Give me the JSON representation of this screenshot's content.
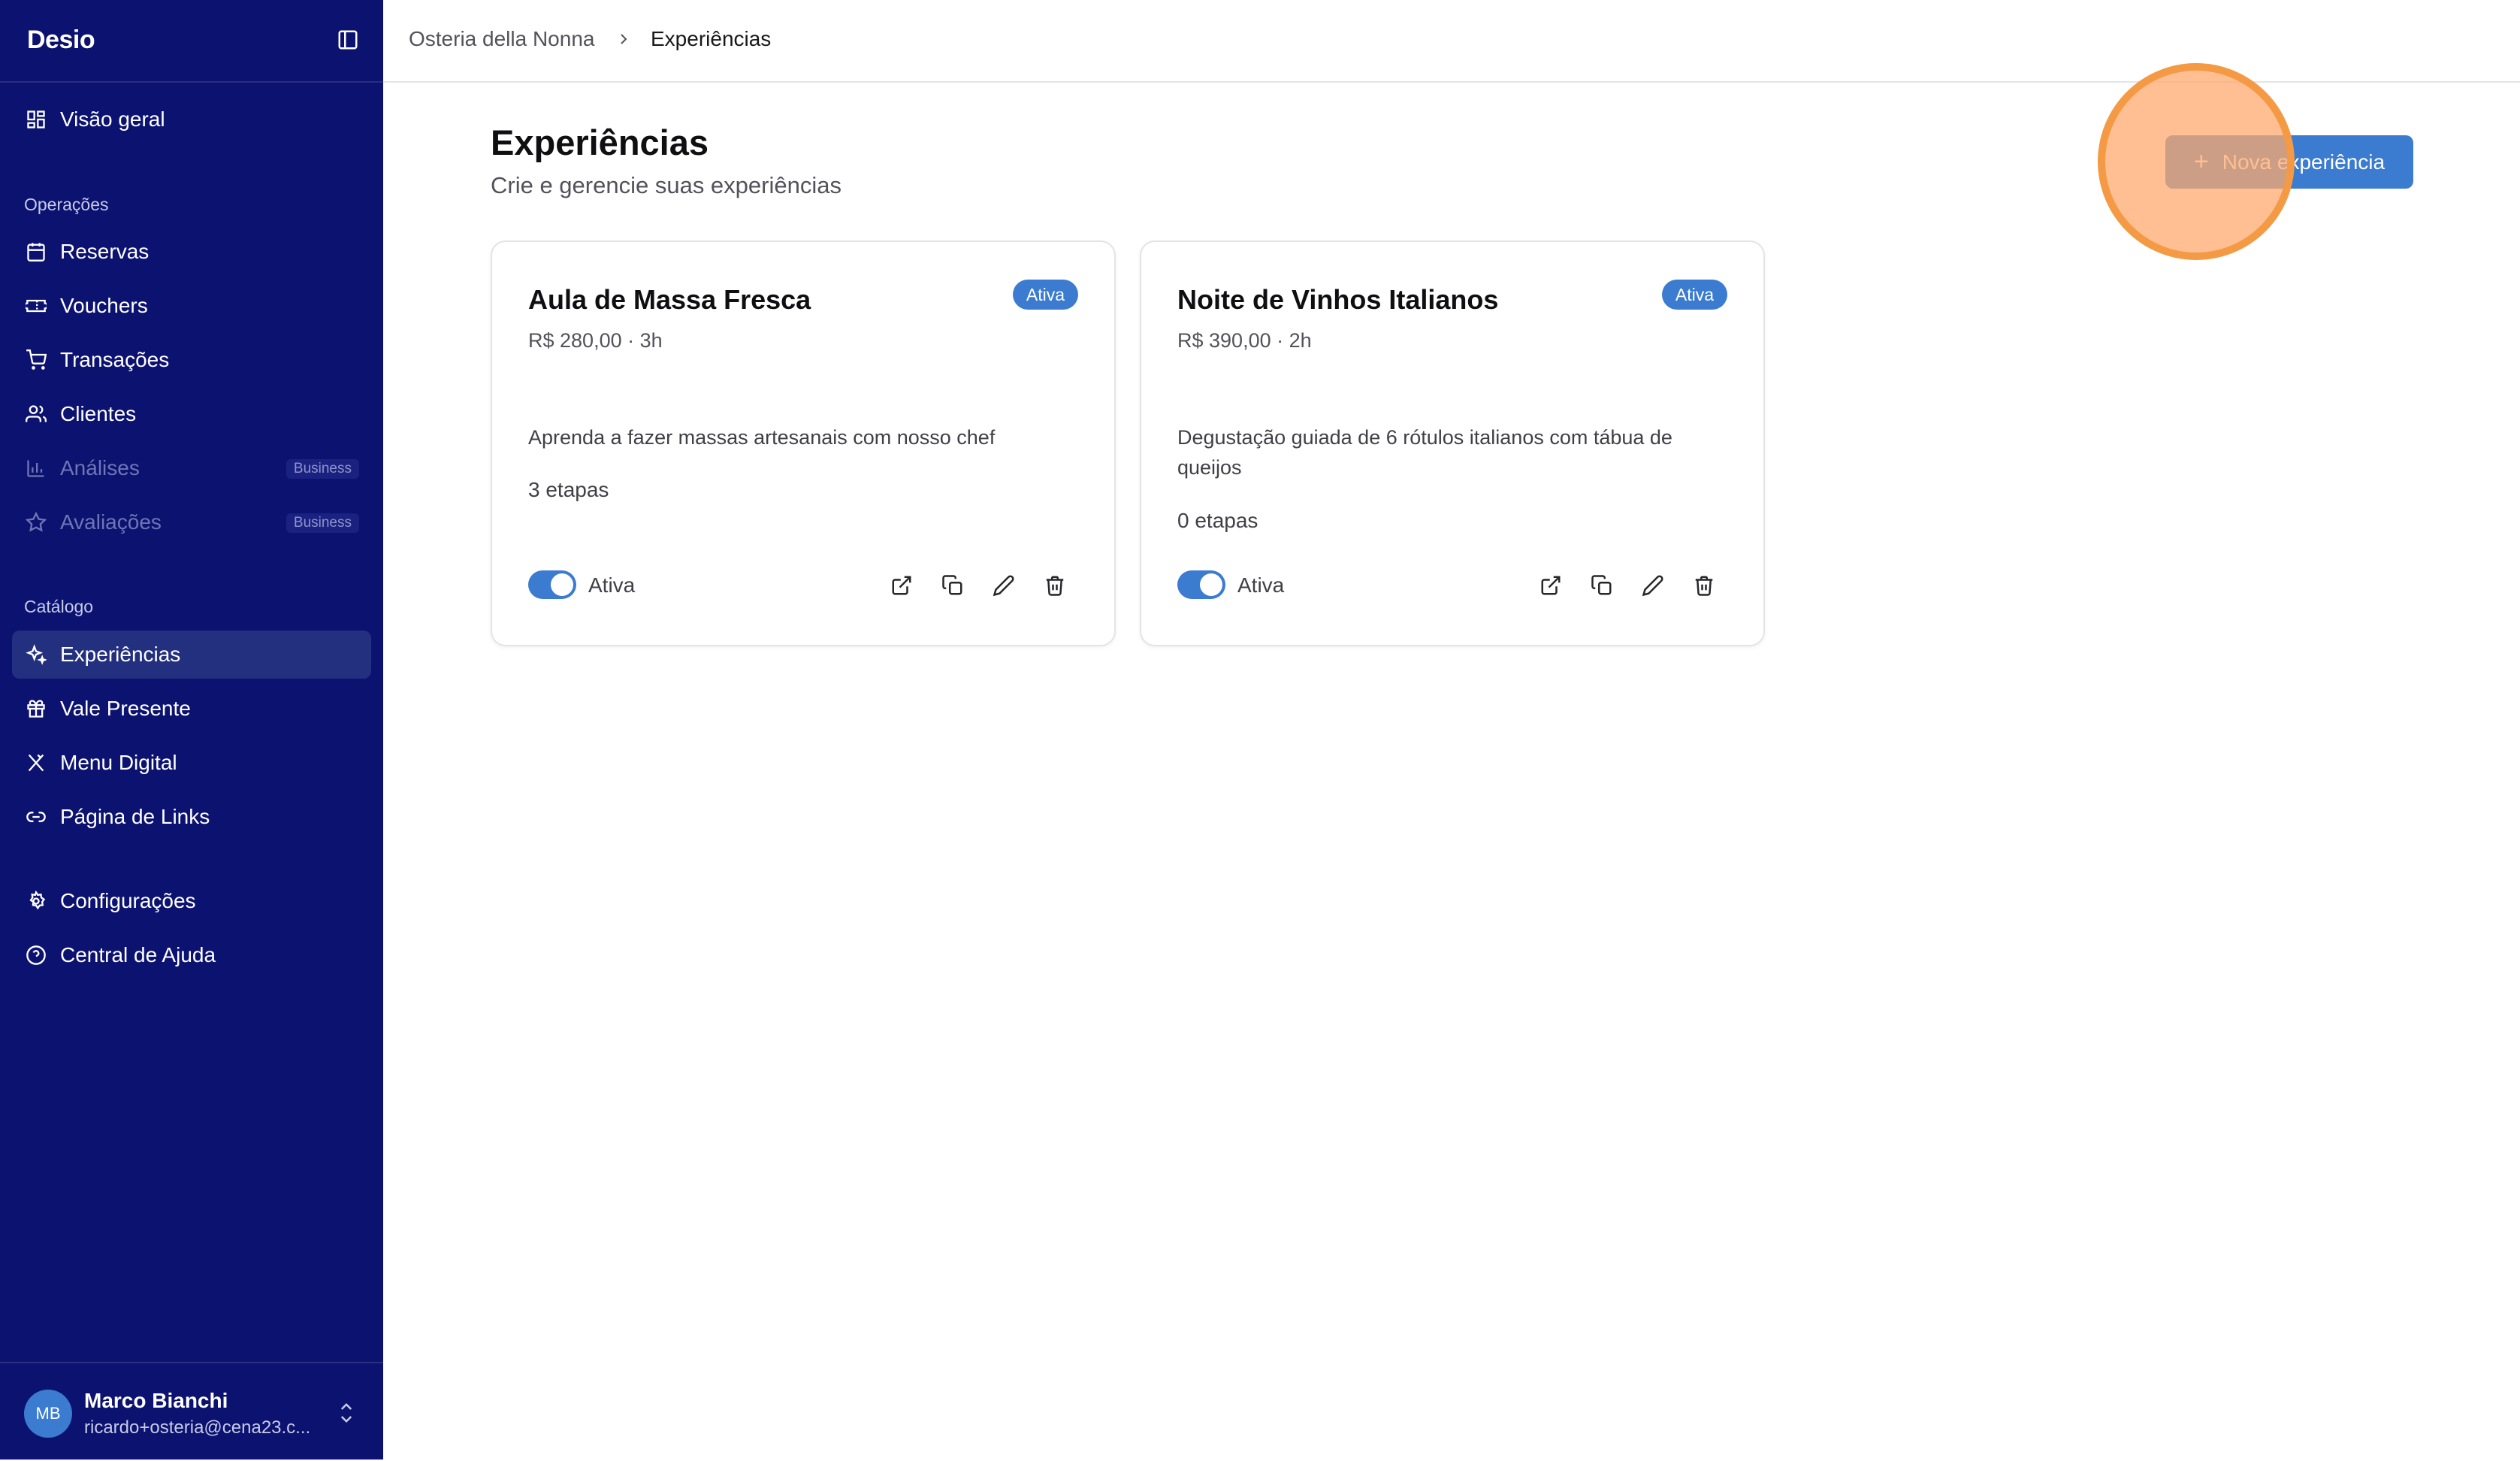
{
  "app": {
    "logo": "Desio"
  },
  "sidebar": {
    "overview": {
      "label": "Visão geral",
      "icon": "layout-grid-icon"
    },
    "operations_label": "Operações",
    "operations": [
      {
        "label": "Reservas",
        "icon": "calendar-icon"
      },
      {
        "label": "Vouchers",
        "icon": "ticket-icon"
      },
      {
        "label": "Transações",
        "icon": "cart-icon"
      },
      {
        "label": "Clientes",
        "icon": "users-icon"
      },
      {
        "label": "Análises",
        "icon": "bar-chart-icon",
        "badge": "Business"
      },
      {
        "label": "Avaliações",
        "icon": "star-icon",
        "badge": "Business"
      }
    ],
    "catalog_label": "Catálogo",
    "catalog": [
      {
        "label": "Experiências",
        "icon": "sparkles-icon",
        "active": true
      },
      {
        "label": "Vale Presente",
        "icon": "gift-icon"
      },
      {
        "label": "Menu Digital",
        "icon": "utensils-icon"
      },
      {
        "label": "Página de Links",
        "icon": "link-icon"
      }
    ],
    "bottom": [
      {
        "label": "Configurações",
        "icon": "gear-icon"
      },
      {
        "label": "Central de Ajuda",
        "icon": "help-circle-icon"
      }
    ],
    "user": {
      "initials": "MB",
      "name": "Marco Bianchi",
      "email": "ricardo+osteria@cena23.c..."
    }
  },
  "breadcrumb": {
    "root": "Osteria della Nonna",
    "current": "Experiências"
  },
  "main": {
    "title": "Experiências",
    "subtitle": "Crie e gerencie suas experiências",
    "new_button": "Nova experiência"
  },
  "experiences": [
    {
      "title": "Aula de Massa Fresca",
      "meta": "R$ 280,00 · 3h",
      "status": "Ativa",
      "description": "Aprenda a fazer massas artesanais com nosso chef",
      "steps": "3 etapas",
      "toggle_label": "Ativa"
    },
    {
      "title": "Noite de Vinhos Italianos",
      "meta": "R$ 390,00 · 2h",
      "status": "Ativa",
      "description": "Degustação guiada de 6 rótulos italianos com tábua de queijos",
      "steps": "0 etapas",
      "toggle_label": "Ativa"
    }
  ],
  "colors": {
    "sidebar": "#0c1270",
    "accent": "#3b7bd0",
    "click_highlight": "#f49a45"
  }
}
